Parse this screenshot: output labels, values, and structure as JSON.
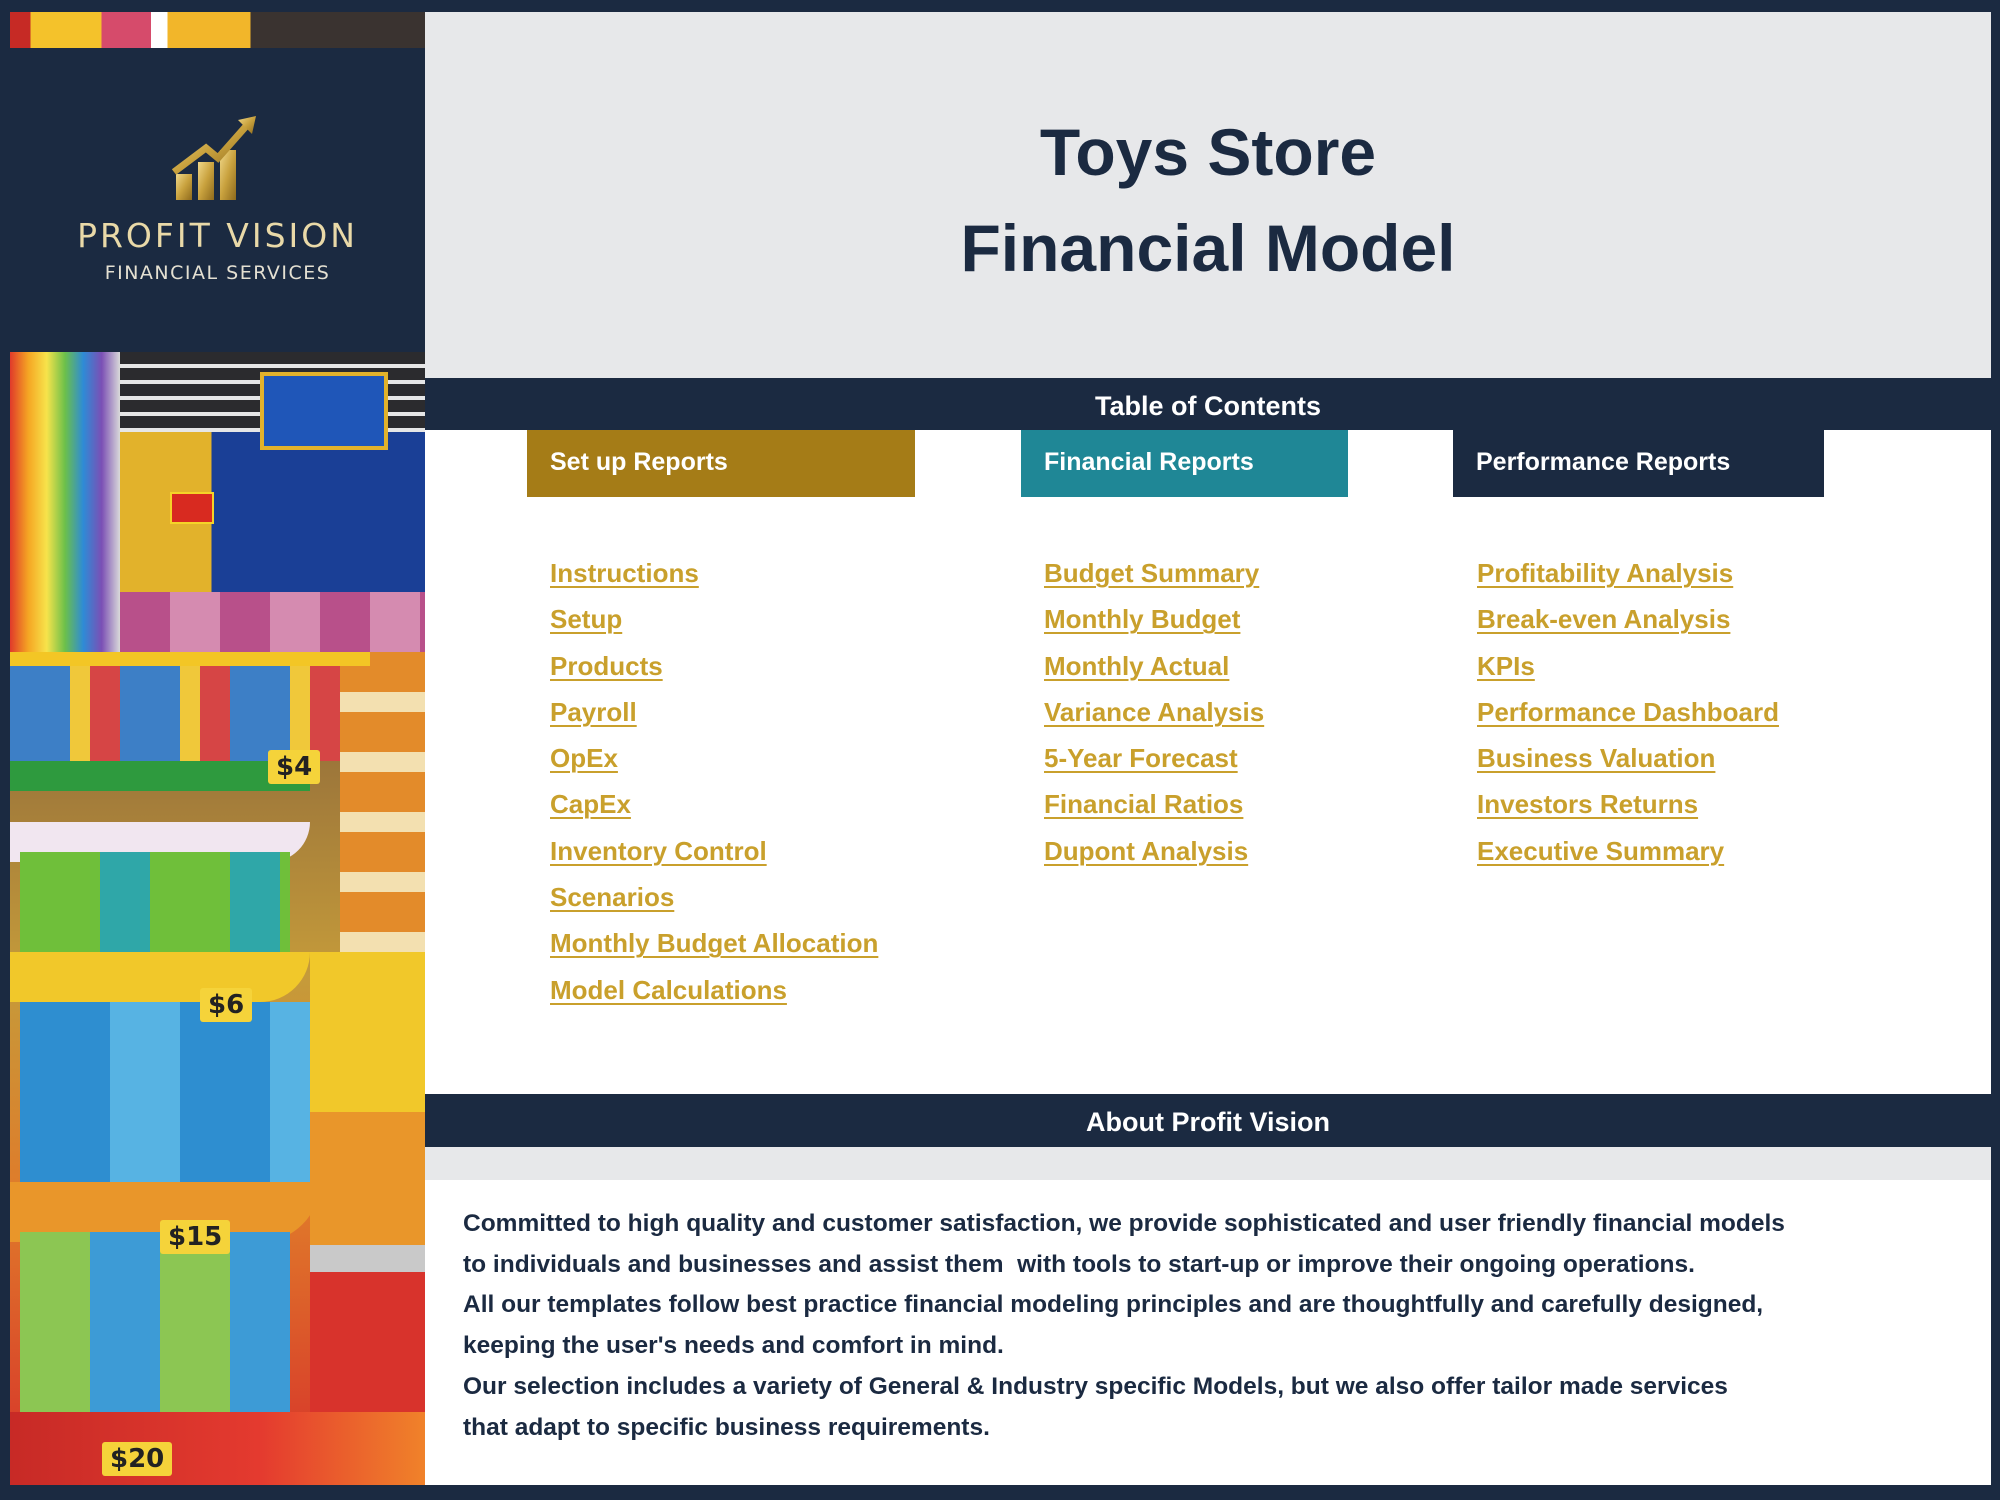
{
  "brand": {
    "name": "PROFIT VISION",
    "subtitle": "FINANCIAL SERVICES",
    "logo_icon": "rising-bar-chart-arrow-icon",
    "colors": {
      "navy": "#1b2a41",
      "gold": "#c9a02c",
      "logo_gold": "#d7b45a"
    }
  },
  "photo": {
    "description": "toy store interior",
    "price_tags": [
      "$4",
      "$6",
      "$15",
      "$20"
    ]
  },
  "header": {
    "title_line1": "Toys Store",
    "title_line2": "Financial Model"
  },
  "toc": {
    "title": "Table of Contents",
    "columns": [
      {
        "header": "Set up Reports",
        "color": "#a57c17",
        "links": [
          "Instructions",
          "Setup",
          "Products",
          "Payroll",
          "OpEx",
          "CapEx",
          "Inventory Control",
          "Scenarios",
          "Monthly Budget Allocation",
          "Model Calculations"
        ]
      },
      {
        "header": "Financial Reports",
        "color": "#1f8796",
        "links": [
          "Budget Summary",
          "Monthly Budget",
          "Monthly Actual",
          "Variance Analysis",
          "5-Year Forecast",
          "Financial Ratios",
          "Dupont Analysis"
        ]
      },
      {
        "header": "Performance Reports",
        "color": "#1b2a41",
        "links": [
          "Profitability Analysis",
          "Break-even Analysis",
          "KPIs",
          "Performance Dashboard",
          "Business Valuation",
          "Investors Returns",
          "Executive Summary"
        ]
      }
    ]
  },
  "about": {
    "title": "About Profit Vision",
    "lines": [
      "Committed to high quality and customer satisfaction, we provide sophisticated and user friendly financial models",
      "to individuals and businesses and assist them  with tools to start-up or improve their ongoing operations.",
      "All our templates follow best practice financial modeling principles and are thoughtfully and carefully designed,",
      "keeping the user's needs and comfort in mind.",
      "Our selection includes a variety of General & Industry specific Models, but we also offer tailor made services",
      "that adapt to specific business requirements."
    ]
  }
}
